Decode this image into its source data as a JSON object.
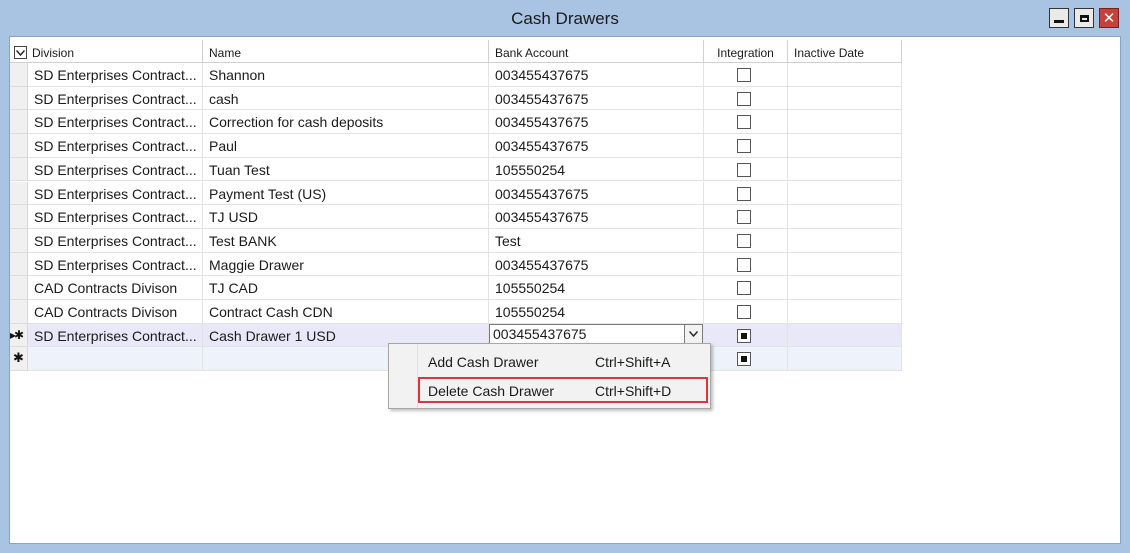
{
  "window": {
    "title": "Cash Drawers",
    "close_glyph": "✕"
  },
  "grid": {
    "columns": {
      "division": "Division",
      "name": "Name",
      "bank_account": "Bank Account",
      "integration": "Integration",
      "inactive_date": "Inactive Date"
    },
    "rows": [
      {
        "division": "SD Enterprises Contract...",
        "name": "Shannon",
        "bank": "003455437675",
        "integration": "unchecked"
      },
      {
        "division": "SD Enterprises Contract...",
        "name": "cash",
        "bank": "003455437675",
        "integration": "unchecked"
      },
      {
        "division": "SD Enterprises Contract...",
        "name": "Correction for cash deposits",
        "bank": "003455437675",
        "integration": "unchecked"
      },
      {
        "division": "SD Enterprises Contract...",
        "name": "Paul",
        "bank": "003455437675",
        "integration": "unchecked"
      },
      {
        "division": "SD Enterprises Contract...",
        "name": "Tuan Test",
        "bank": "105550254",
        "integration": "unchecked"
      },
      {
        "division": "SD Enterprises Contract...",
        "name": "Payment Test (US)",
        "bank": "003455437675",
        "integration": "unchecked"
      },
      {
        "division": "SD Enterprises Contract...",
        "name": "TJ USD",
        "bank": "003455437675",
        "integration": "unchecked"
      },
      {
        "division": "SD Enterprises Contract...",
        "name": "Test BANK",
        "bank": "Test",
        "integration": "unchecked"
      },
      {
        "division": "SD Enterprises Contract...",
        "name": "Maggie Drawer",
        "bank": "003455437675",
        "integration": "unchecked"
      },
      {
        "division": "CAD Contracts Divison",
        "name": "TJ CAD",
        "bank": "105550254",
        "integration": "unchecked"
      },
      {
        "division": "CAD Contracts Divison",
        "name": "Contract Cash CDN",
        "bank": "105550254",
        "integration": "unchecked"
      }
    ],
    "current_row": {
      "marker": "▸✱",
      "division": "SD Enterprises Contract...",
      "name": "Cash Drawer 1 USD",
      "bank": "003455437675",
      "integration": "indeterminate"
    },
    "new_row": {
      "marker": "✱",
      "integration": "indeterminate"
    }
  },
  "context_menu": {
    "items": [
      {
        "label": "Add Cash Drawer",
        "shortcut": "Ctrl+Shift+A"
      },
      {
        "label": "Delete Cash Drawer",
        "shortcut": "Ctrl+Shift+D"
      }
    ]
  },
  "colors": {
    "frame": "#a9c4e3",
    "highlight_border": "#d9363e",
    "current_row": "#e8e8f8"
  }
}
